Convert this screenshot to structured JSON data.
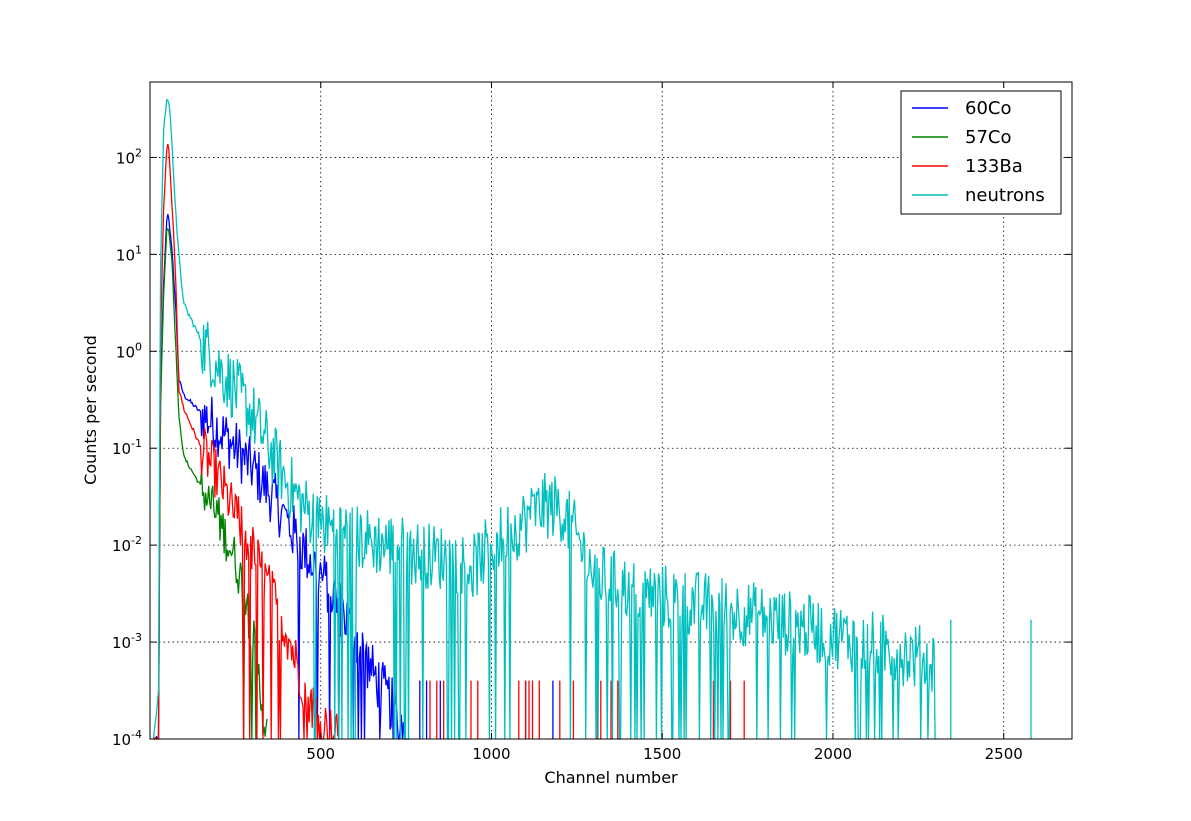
{
  "chart_data": {
    "type": "line",
    "title": "",
    "xlabel": "Channel number",
    "ylabel": "Counts per second",
    "xlim": [
      0,
      2700
    ],
    "ylim": [
      0.0001,
      600
    ],
    "yscale": "log",
    "grid": true,
    "legend_position": "top-right",
    "x_ticks": [
      {
        "value": 500,
        "label": "500"
      },
      {
        "value": 1000,
        "label": "1000"
      },
      {
        "value": 1500,
        "label": "1500"
      },
      {
        "value": 2000,
        "label": "2000"
      },
      {
        "value": 2500,
        "label": "2500"
      }
    ],
    "y_ticks": [
      {
        "value": 0.0001,
        "base": "10",
        "exp": "-4"
      },
      {
        "value": 0.001,
        "base": "10",
        "exp": "-3"
      },
      {
        "value": 0.01,
        "base": "10",
        "exp": "-2"
      },
      {
        "value": 0.1,
        "base": "10",
        "exp": "-1"
      },
      {
        "value": 1,
        "base": "10",
        "exp": "0"
      },
      {
        "value": 10,
        "base": "10",
        "exp": "1"
      },
      {
        "value": 100,
        "base": "10",
        "exp": "2"
      }
    ],
    "series": [
      {
        "name": "60Co",
        "color": "#0000ff",
        "noise": 0.6,
        "points": [
          [
            10,
            0.0001
          ],
          [
            25,
            0.0001
          ],
          [
            30,
            0.3
          ],
          [
            40,
            5
          ],
          [
            50,
            27
          ],
          [
            55,
            24
          ],
          [
            65,
            10
          ],
          [
            75,
            3
          ],
          [
            85,
            0.5
          ],
          [
            100,
            0.35
          ],
          [
            150,
            0.23
          ],
          [
            200,
            0.16
          ],
          [
            250,
            0.1
          ],
          [
            300,
            0.062
          ],
          [
            350,
            0.035
          ],
          [
            400,
            0.018
          ],
          [
            450,
            0.009
          ],
          [
            500,
            0.005
          ],
          [
            550,
            0.0025
          ],
          [
            600,
            0.0012
          ],
          [
            650,
            0.0005
          ],
          [
            700,
            0.00025
          ],
          [
            760,
            0.0001
          ]
        ],
        "spikes": [
          790,
          810,
          850,
          1100,
          1180
        ]
      },
      {
        "name": "57Co",
        "color": "#008000",
        "noise": 0.5,
        "points": [
          [
            10,
            0.0001
          ],
          [
            25,
            0.0001
          ],
          [
            30,
            0.2
          ],
          [
            40,
            4
          ],
          [
            50,
            20
          ],
          [
            55,
            18
          ],
          [
            65,
            8
          ],
          [
            75,
            1.2
          ],
          [
            85,
            0.2
          ],
          [
            100,
            0.08
          ],
          [
            150,
            0.04
          ],
          [
            200,
            0.019
          ],
          [
            250,
            0.007
          ],
          [
            280,
            0.003
          ],
          [
            300,
            0.0012
          ],
          [
            320,
            0.0004
          ],
          [
            330,
            0.0002
          ],
          [
            345,
            0.0001
          ]
        ],
        "spikes": []
      },
      {
        "name": "133Ba",
        "color": "#ff0000",
        "noise": 0.55,
        "points": [
          [
            10,
            0.0001
          ],
          [
            25,
            0.0001
          ],
          [
            30,
            1
          ],
          [
            40,
            30
          ],
          [
            50,
            140
          ],
          [
            55,
            120
          ],
          [
            65,
            30
          ],
          [
            75,
            6
          ],
          [
            85,
            0.4
          ],
          [
            100,
            0.25
          ],
          [
            150,
            0.1
          ],
          [
            200,
            0.05
          ],
          [
            250,
            0.02
          ],
          [
            300,
            0.009
          ],
          [
            350,
            0.0035
          ],
          [
            400,
            0.0013
          ],
          [
            430,
            0.0006
          ],
          [
            460,
            0.0003
          ],
          [
            500,
            0.00015
          ],
          [
            550,
            0.0001
          ]
        ],
        "spikes": [
          820,
          840,
          860,
          940,
          960,
          1080,
          1100,
          1110,
          1120,
          1140,
          1200,
          1240,
          1310,
          1320,
          1350,
          1370,
          1650,
          1700,
          1740
        ]
      },
      {
        "name": "neutrons",
        "color": "#00bfbf",
        "noise": 0.7,
        "points": [
          [
            10,
            0.0001
          ],
          [
            25,
            0.0003
          ],
          [
            30,
            5
          ],
          [
            40,
            200
          ],
          [
            50,
            420
          ],
          [
            58,
            320
          ],
          [
            70,
            60
          ],
          [
            80,
            15
          ],
          [
            90,
            6
          ],
          [
            100,
            3
          ],
          [
            150,
            1.3
          ],
          [
            200,
            0.7
          ],
          [
            250,
            0.4
          ],
          [
            300,
            0.22
          ],
          [
            350,
            0.1
          ],
          [
            400,
            0.045
          ],
          [
            450,
            0.025
          ],
          [
            500,
            0.017
          ],
          [
            600,
            0.012
          ],
          [
            700,
            0.01
          ],
          [
            800,
            0.008
          ],
          [
            900,
            0.007
          ],
          [
            950,
            0.006
          ],
          [
            1000,
            0.01
          ],
          [
            1100,
            0.018
          ],
          [
            1150,
            0.025
          ],
          [
            1200,
            0.025
          ],
          [
            1250,
            0.012
          ],
          [
            1300,
            0.005
          ],
          [
            1400,
            0.0035
          ],
          [
            1600,
            0.0025
          ],
          [
            1800,
            0.0018
          ],
          [
            2000,
            0.0012
          ],
          [
            2200,
            0.0008
          ],
          [
            2300,
            0.0006
          ]
        ],
        "spikes": [
          2345,
          2580
        ]
      }
    ]
  }
}
